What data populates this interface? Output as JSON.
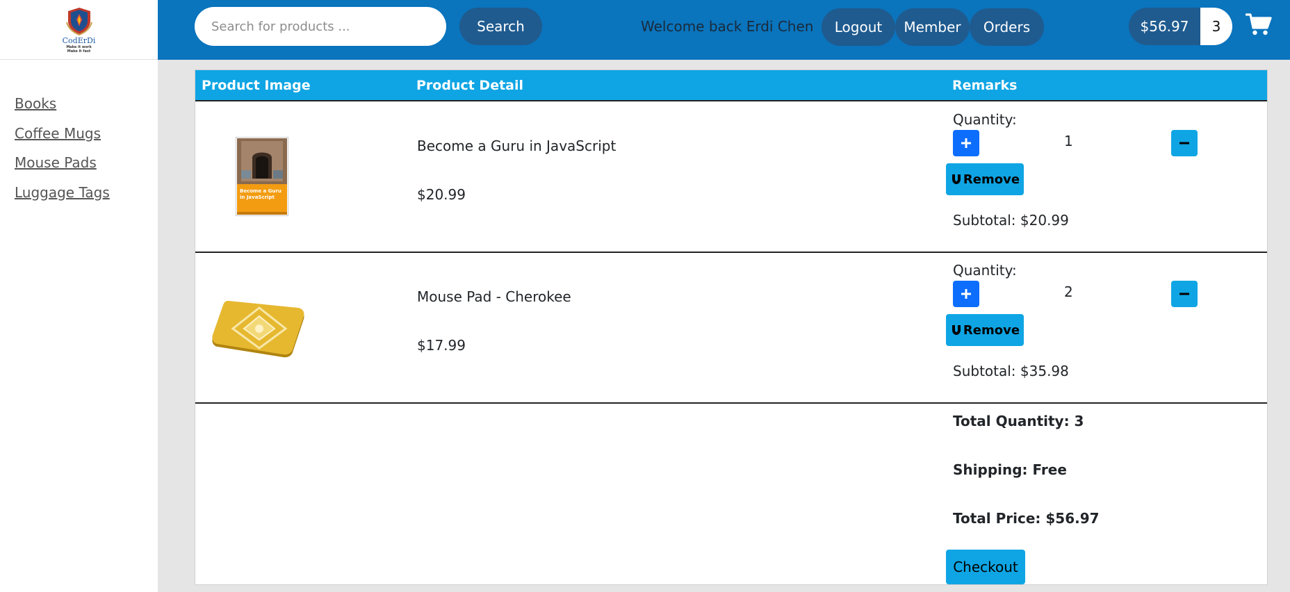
{
  "brand": {
    "name": "CodErDi",
    "tagline_1": "Make it work",
    "tagline_2": "Make it fast"
  },
  "sidebar": {
    "items": [
      {
        "label": "Books"
      },
      {
        "label": "Coffee Mugs"
      },
      {
        "label": "Mouse Pads"
      },
      {
        "label": "Luggage Tags"
      }
    ]
  },
  "header": {
    "search_placeholder": "Search for products ...",
    "search_label": "Search",
    "welcome": "Welcome back Erdi Chen",
    "logout_label": "Logout",
    "member_label": "Member",
    "orders_label": "Orders",
    "cart_total": "$56.97",
    "cart_count": "3",
    "cart_icon": "shopping-cart-icon"
  },
  "table": {
    "headers": {
      "image": "Product Image",
      "detail": "Product Detail",
      "remarks": "Remarks"
    },
    "rows": [
      {
        "name": "Become a Guru in JavaScript",
        "price": "$20.99",
        "quantity_label": "Quantity:",
        "quantity": "1",
        "remove_label": "Remove",
        "subtotal": "Subtotal: $20.99",
        "cover_title": "Become a Guru in JavaScript"
      },
      {
        "name": "Mouse Pad - Cherokee",
        "price": "$17.99",
        "quantity_label": "Quantity:",
        "quantity": "2",
        "remove_label": "Remove",
        "subtotal": "Subtotal: $35.98"
      }
    ],
    "summary": {
      "total_quantity": "Total Quantity: 3",
      "shipping": "Shipping: Free",
      "total_price": "Total Price: $56.97",
      "checkout_label": "Checkout"
    }
  },
  "colors": {
    "header_bg": "#0a74bd",
    "pill_bg": "#1f5b8f",
    "table_header_bg": "#0fa5e4",
    "plus_button": "#0d6efd",
    "accent_button": "#0fa5e4"
  }
}
